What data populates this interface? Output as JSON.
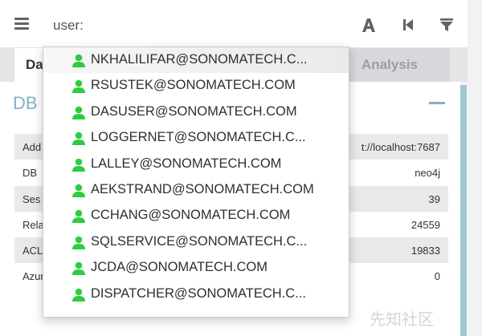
{
  "search": {
    "value": "user:",
    "placeholder": ""
  },
  "toolbar": {
    "icons": [
      "font-icon",
      "skip-back-icon",
      "filter-icon"
    ]
  },
  "tabs": [
    {
      "label": "Da"
    },
    {
      "label": "Analysis"
    }
  ],
  "panel": {
    "title": "DB",
    "rows": [
      {
        "label": "Add",
        "value": "t://localhost:7687"
      },
      {
        "label": "DB",
        "value": "neo4j"
      },
      {
        "label": "Ses",
        "value": "39"
      },
      {
        "label": "Rela",
        "value": "24559"
      },
      {
        "label": "ACL",
        "value": "19833"
      },
      {
        "label": "Azure Relationships",
        "value": "0"
      }
    ]
  },
  "autocomplete": {
    "items": [
      {
        "label": "NKHALILIFAR@SONOMATECH.C..."
      },
      {
        "label": "RSUSTEK@SONOMATECH.COM"
      },
      {
        "label": "DASUSER@SONOMATECH.COM"
      },
      {
        "label": "LOGGERNET@SONOMATECH.C..."
      },
      {
        "label": "LALLEY@SONOMATECH.COM"
      },
      {
        "label": "AEKSTRAND@SONOMATECH.COM"
      },
      {
        "label": "CCHANG@SONOMATECH.COM"
      },
      {
        "label": "SQLSERVICE@SONOMATECH.C..."
      },
      {
        "label": "JCDA@SONOMATECH.COM"
      },
      {
        "label": "DISPATCHER@SONOMATECH.C..."
      }
    ],
    "icon": "user-icon",
    "icon_color": "#2ecc40"
  },
  "watermark": "先知社区",
  "colors": {
    "accent": "#7fb2c5",
    "user_icon": "#2ecc40",
    "scroll_strip": "#9fc7cf"
  }
}
